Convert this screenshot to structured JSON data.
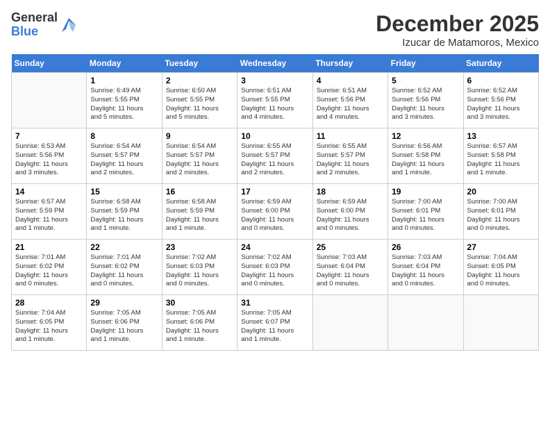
{
  "logo": {
    "general": "General",
    "blue": "Blue"
  },
  "header": {
    "month": "December 2025",
    "location": "Izucar de Matamoros, Mexico"
  },
  "weekdays": [
    "Sunday",
    "Monday",
    "Tuesday",
    "Wednesday",
    "Thursday",
    "Friday",
    "Saturday"
  ],
  "weeks": [
    [
      {
        "day": "",
        "info": ""
      },
      {
        "day": "1",
        "info": "Sunrise: 6:49 AM\nSunset: 5:55 PM\nDaylight: 11 hours\nand 5 minutes."
      },
      {
        "day": "2",
        "info": "Sunrise: 6:50 AM\nSunset: 5:55 PM\nDaylight: 11 hours\nand 5 minutes."
      },
      {
        "day": "3",
        "info": "Sunrise: 6:51 AM\nSunset: 5:55 PM\nDaylight: 11 hours\nand 4 minutes."
      },
      {
        "day": "4",
        "info": "Sunrise: 6:51 AM\nSunset: 5:56 PM\nDaylight: 11 hours\nand 4 minutes."
      },
      {
        "day": "5",
        "info": "Sunrise: 6:52 AM\nSunset: 5:56 PM\nDaylight: 11 hours\nand 3 minutes."
      },
      {
        "day": "6",
        "info": "Sunrise: 6:52 AM\nSunset: 5:56 PM\nDaylight: 11 hours\nand 3 minutes."
      }
    ],
    [
      {
        "day": "7",
        "info": "Sunrise: 6:53 AM\nSunset: 5:56 PM\nDaylight: 11 hours\nand 3 minutes."
      },
      {
        "day": "8",
        "info": "Sunrise: 6:54 AM\nSunset: 5:57 PM\nDaylight: 11 hours\nand 2 minutes."
      },
      {
        "day": "9",
        "info": "Sunrise: 6:54 AM\nSunset: 5:57 PM\nDaylight: 11 hours\nand 2 minutes."
      },
      {
        "day": "10",
        "info": "Sunrise: 6:55 AM\nSunset: 5:57 PM\nDaylight: 11 hours\nand 2 minutes."
      },
      {
        "day": "11",
        "info": "Sunrise: 6:55 AM\nSunset: 5:57 PM\nDaylight: 11 hours\nand 2 minutes."
      },
      {
        "day": "12",
        "info": "Sunrise: 6:56 AM\nSunset: 5:58 PM\nDaylight: 11 hours\nand 1 minute."
      },
      {
        "day": "13",
        "info": "Sunrise: 6:57 AM\nSunset: 5:58 PM\nDaylight: 11 hours\nand 1 minute."
      }
    ],
    [
      {
        "day": "14",
        "info": "Sunrise: 6:57 AM\nSunset: 5:59 PM\nDaylight: 11 hours\nand 1 minute."
      },
      {
        "day": "15",
        "info": "Sunrise: 6:58 AM\nSunset: 5:59 PM\nDaylight: 11 hours\nand 1 minute."
      },
      {
        "day": "16",
        "info": "Sunrise: 6:58 AM\nSunset: 5:59 PM\nDaylight: 11 hours\nand 1 minute."
      },
      {
        "day": "17",
        "info": "Sunrise: 6:59 AM\nSunset: 6:00 PM\nDaylight: 11 hours\nand 0 minutes."
      },
      {
        "day": "18",
        "info": "Sunrise: 6:59 AM\nSunset: 6:00 PM\nDaylight: 11 hours\nand 0 minutes."
      },
      {
        "day": "19",
        "info": "Sunrise: 7:00 AM\nSunset: 6:01 PM\nDaylight: 11 hours\nand 0 minutes."
      },
      {
        "day": "20",
        "info": "Sunrise: 7:00 AM\nSunset: 6:01 PM\nDaylight: 11 hours\nand 0 minutes."
      }
    ],
    [
      {
        "day": "21",
        "info": "Sunrise: 7:01 AM\nSunset: 6:02 PM\nDaylight: 11 hours\nand 0 minutes."
      },
      {
        "day": "22",
        "info": "Sunrise: 7:01 AM\nSunset: 6:02 PM\nDaylight: 11 hours\nand 0 minutes."
      },
      {
        "day": "23",
        "info": "Sunrise: 7:02 AM\nSunset: 6:03 PM\nDaylight: 11 hours\nand 0 minutes."
      },
      {
        "day": "24",
        "info": "Sunrise: 7:02 AM\nSunset: 6:03 PM\nDaylight: 11 hours\nand 0 minutes."
      },
      {
        "day": "25",
        "info": "Sunrise: 7:03 AM\nSunset: 6:04 PM\nDaylight: 11 hours\nand 0 minutes."
      },
      {
        "day": "26",
        "info": "Sunrise: 7:03 AM\nSunset: 6:04 PM\nDaylight: 11 hours\nand 0 minutes."
      },
      {
        "day": "27",
        "info": "Sunrise: 7:04 AM\nSunset: 6:05 PM\nDaylight: 11 hours\nand 0 minutes."
      }
    ],
    [
      {
        "day": "28",
        "info": "Sunrise: 7:04 AM\nSunset: 6:05 PM\nDaylight: 11 hours\nand 1 minute."
      },
      {
        "day": "29",
        "info": "Sunrise: 7:05 AM\nSunset: 6:06 PM\nDaylight: 11 hours\nand 1 minute."
      },
      {
        "day": "30",
        "info": "Sunrise: 7:05 AM\nSunset: 6:06 PM\nDaylight: 11 hours\nand 1 minute."
      },
      {
        "day": "31",
        "info": "Sunrise: 7:05 AM\nSunset: 6:07 PM\nDaylight: 11 hours\nand 1 minute."
      },
      {
        "day": "",
        "info": ""
      },
      {
        "day": "",
        "info": ""
      },
      {
        "day": "",
        "info": ""
      }
    ]
  ]
}
